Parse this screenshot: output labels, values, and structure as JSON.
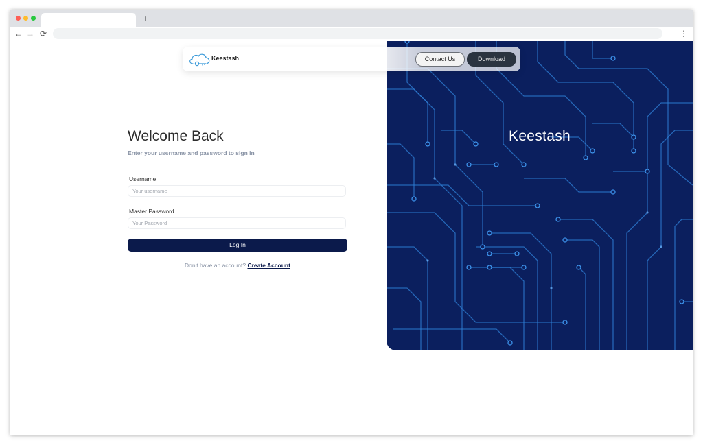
{
  "browser": {
    "new_tab_symbol": "+",
    "back_icon": "arrow-left-icon",
    "forward_icon": "arrow-right-icon",
    "reload_icon": "reload-icon",
    "menu_icon": "kebab-menu-icon"
  },
  "navbar": {
    "brand": "Keestash",
    "logo_icon": "cloud-key-icon",
    "contact_label": "Contact Us",
    "download_label": "Download"
  },
  "hero": {
    "title": "Keestash"
  },
  "form": {
    "title": "Welcome Back",
    "subtitle": "Enter your username and password to sign in",
    "username_label": "Username",
    "username_placeholder": "Your username",
    "password_label": "Master Password",
    "password_placeholder": "Your Password",
    "login_label": "Log In",
    "signup_prompt": "Don't have an account?",
    "signup_link": "Create Account"
  },
  "colors": {
    "hero_background": "#0b1f5e",
    "circuit_trace": "#2f7fd6",
    "primary_button": "#0b1a4b",
    "download_button": "#2b3440",
    "muted_text": "#8a94a6"
  }
}
